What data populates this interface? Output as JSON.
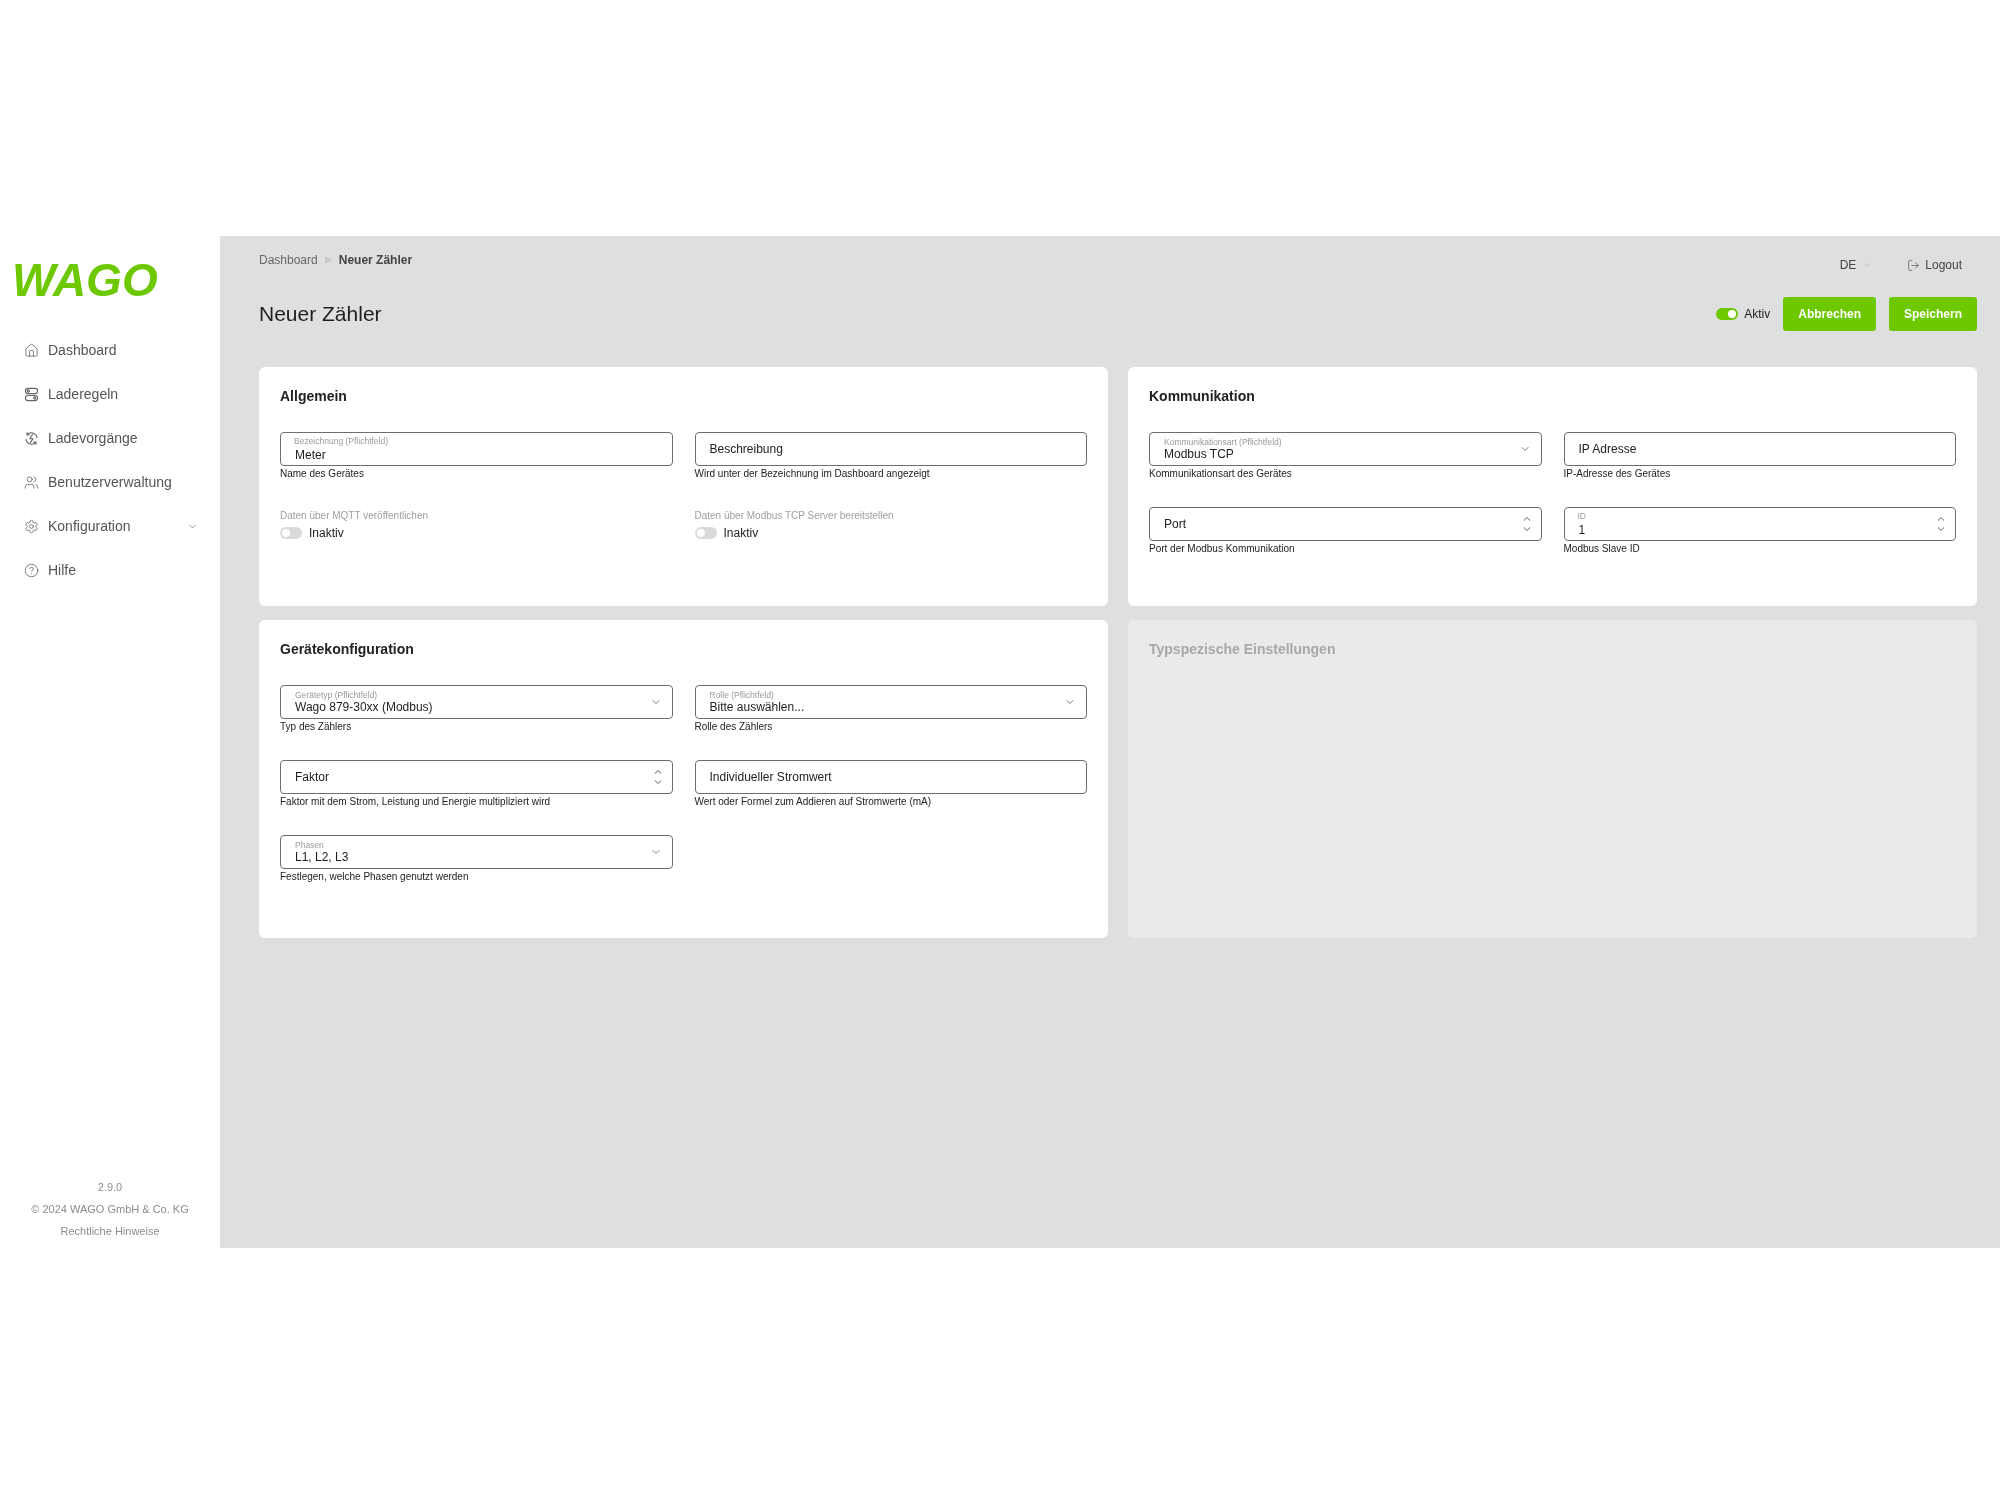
{
  "logo": {
    "text": "WAGO"
  },
  "sidebar": {
    "items": [
      {
        "label": "Dashboard",
        "kind": "link"
      },
      {
        "label": "Laderegeln",
        "kind": "link"
      },
      {
        "label": "Ladevorgänge",
        "kind": "link"
      },
      {
        "label": "Benutzerverwaltung",
        "kind": "link"
      },
      {
        "label": "Konfiguration",
        "kind": "group"
      },
      {
        "label": "Hilfe",
        "kind": "link"
      }
    ],
    "footer": {
      "version": "2.9.0",
      "copyright": "© 2024 WAGO GmbH & Co. KG",
      "legal_link": "Rechtliche Hinweise"
    }
  },
  "breadcrumb": [
    {
      "label": "Dashboard",
      "current": false
    },
    {
      "label": "Neuer Zähler",
      "current": true
    }
  ],
  "language": "DE",
  "logout": "Logout",
  "page_title": "Neuer Zähler",
  "active_switch": {
    "label": "Aktiv",
    "on": true
  },
  "buttons": [
    "Abbrechen",
    "Speichern"
  ],
  "cards": [
    {
      "title": "Allgemein",
      "disabled": false,
      "fields": [
        {
          "kind": "text",
          "label": "Bezeichnung (Pflichtfeld)",
          "value": "Meter",
          "hint": "Name des Gerätes"
        },
        {
          "kind": "text",
          "placeholder": "Beschreibung",
          "hint": "Wird unter der Bezeichnung im Dashboard angezeigt"
        },
        {
          "kind": "switch",
          "label": "Daten über MQTT veröffentlichen",
          "on": false,
          "state_label": "Inaktiv"
        },
        {
          "kind": "switch",
          "label": "Daten über Modbus TCP Server bereitstellen",
          "on": false,
          "state_label": "Inaktiv"
        }
      ]
    },
    {
      "title": "Kommunikation",
      "disabled": false,
      "fields": [
        {
          "kind": "select",
          "label": "Kommunikationsart (Pflichtfeld)",
          "value": "Modbus TCP",
          "hint": "Kommunikationsart des Gerätes"
        },
        {
          "kind": "text",
          "placeholder": "IP Adresse",
          "hint": "IP-Adresse des Gerätes"
        },
        {
          "kind": "number",
          "placeholder": "Port",
          "hint": "Port der Modbus Kommunikation"
        },
        {
          "kind": "number",
          "label": "ID",
          "value": "1",
          "hint": "Modbus Slave ID"
        }
      ]
    },
    {
      "title": "Gerätekonfiguration",
      "disabled": false,
      "fields": [
        {
          "kind": "select",
          "label": "Gerätetyp (Pflichtfeld)",
          "value": "Wago 879-30xx (Modbus)",
          "hint": "Typ des Zählers"
        },
        {
          "kind": "select",
          "label": "Rolle (Pflichtfeld)",
          "value": "Bitte auswählen...",
          "hint": "Rolle des Zählers"
        },
        {
          "kind": "number",
          "placeholder": "Faktor",
          "hint": "Faktor mit dem Strom, Leistung und Energie multipliziert wird"
        },
        {
          "kind": "text",
          "placeholder": "Individueller Stromwert",
          "hint": "Wert oder Formel zum Addieren auf Stromwerte (mA)"
        },
        {
          "kind": "select",
          "label": "Phasen",
          "value": "L1, L2, L3",
          "hint": "Festlegen, welche Phasen genutzt werden"
        }
      ]
    },
    {
      "title": "Typspezische Einstellungen",
      "disabled": true
    }
  ]
}
